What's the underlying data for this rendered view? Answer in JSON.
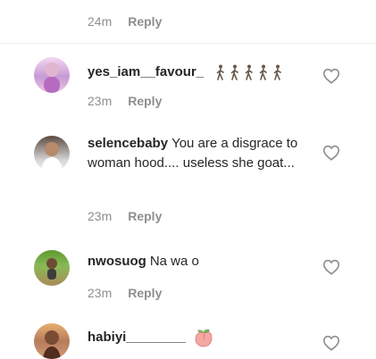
{
  "top_comment_meta": {
    "time": "24m",
    "reply_label": "Reply"
  },
  "comments": [
    {
      "username": "yes_iam__favour_",
      "text": "",
      "time": "23m",
      "reply_label": "Reply",
      "emoji_count": 5
    },
    {
      "username": "selencebaby",
      "text": "You are a disgrace to woman hood.... useless she goat...",
      "time": "23m",
      "reply_label": "Reply"
    },
    {
      "username": "nwosuog",
      "text": "Na wa o",
      "time": "23m",
      "reply_label": "Reply"
    },
    {
      "username": "habiyi________",
      "text": "",
      "time": "",
      "reply_label": ""
    }
  ],
  "icons": {
    "like": "heart-icon",
    "emoji_runner": "runner-emoji",
    "emoji_peach": "peach-emoji"
  },
  "colors": {
    "text": "#262626",
    "meta": "#8e8e8e",
    "divider": "#efefef"
  }
}
